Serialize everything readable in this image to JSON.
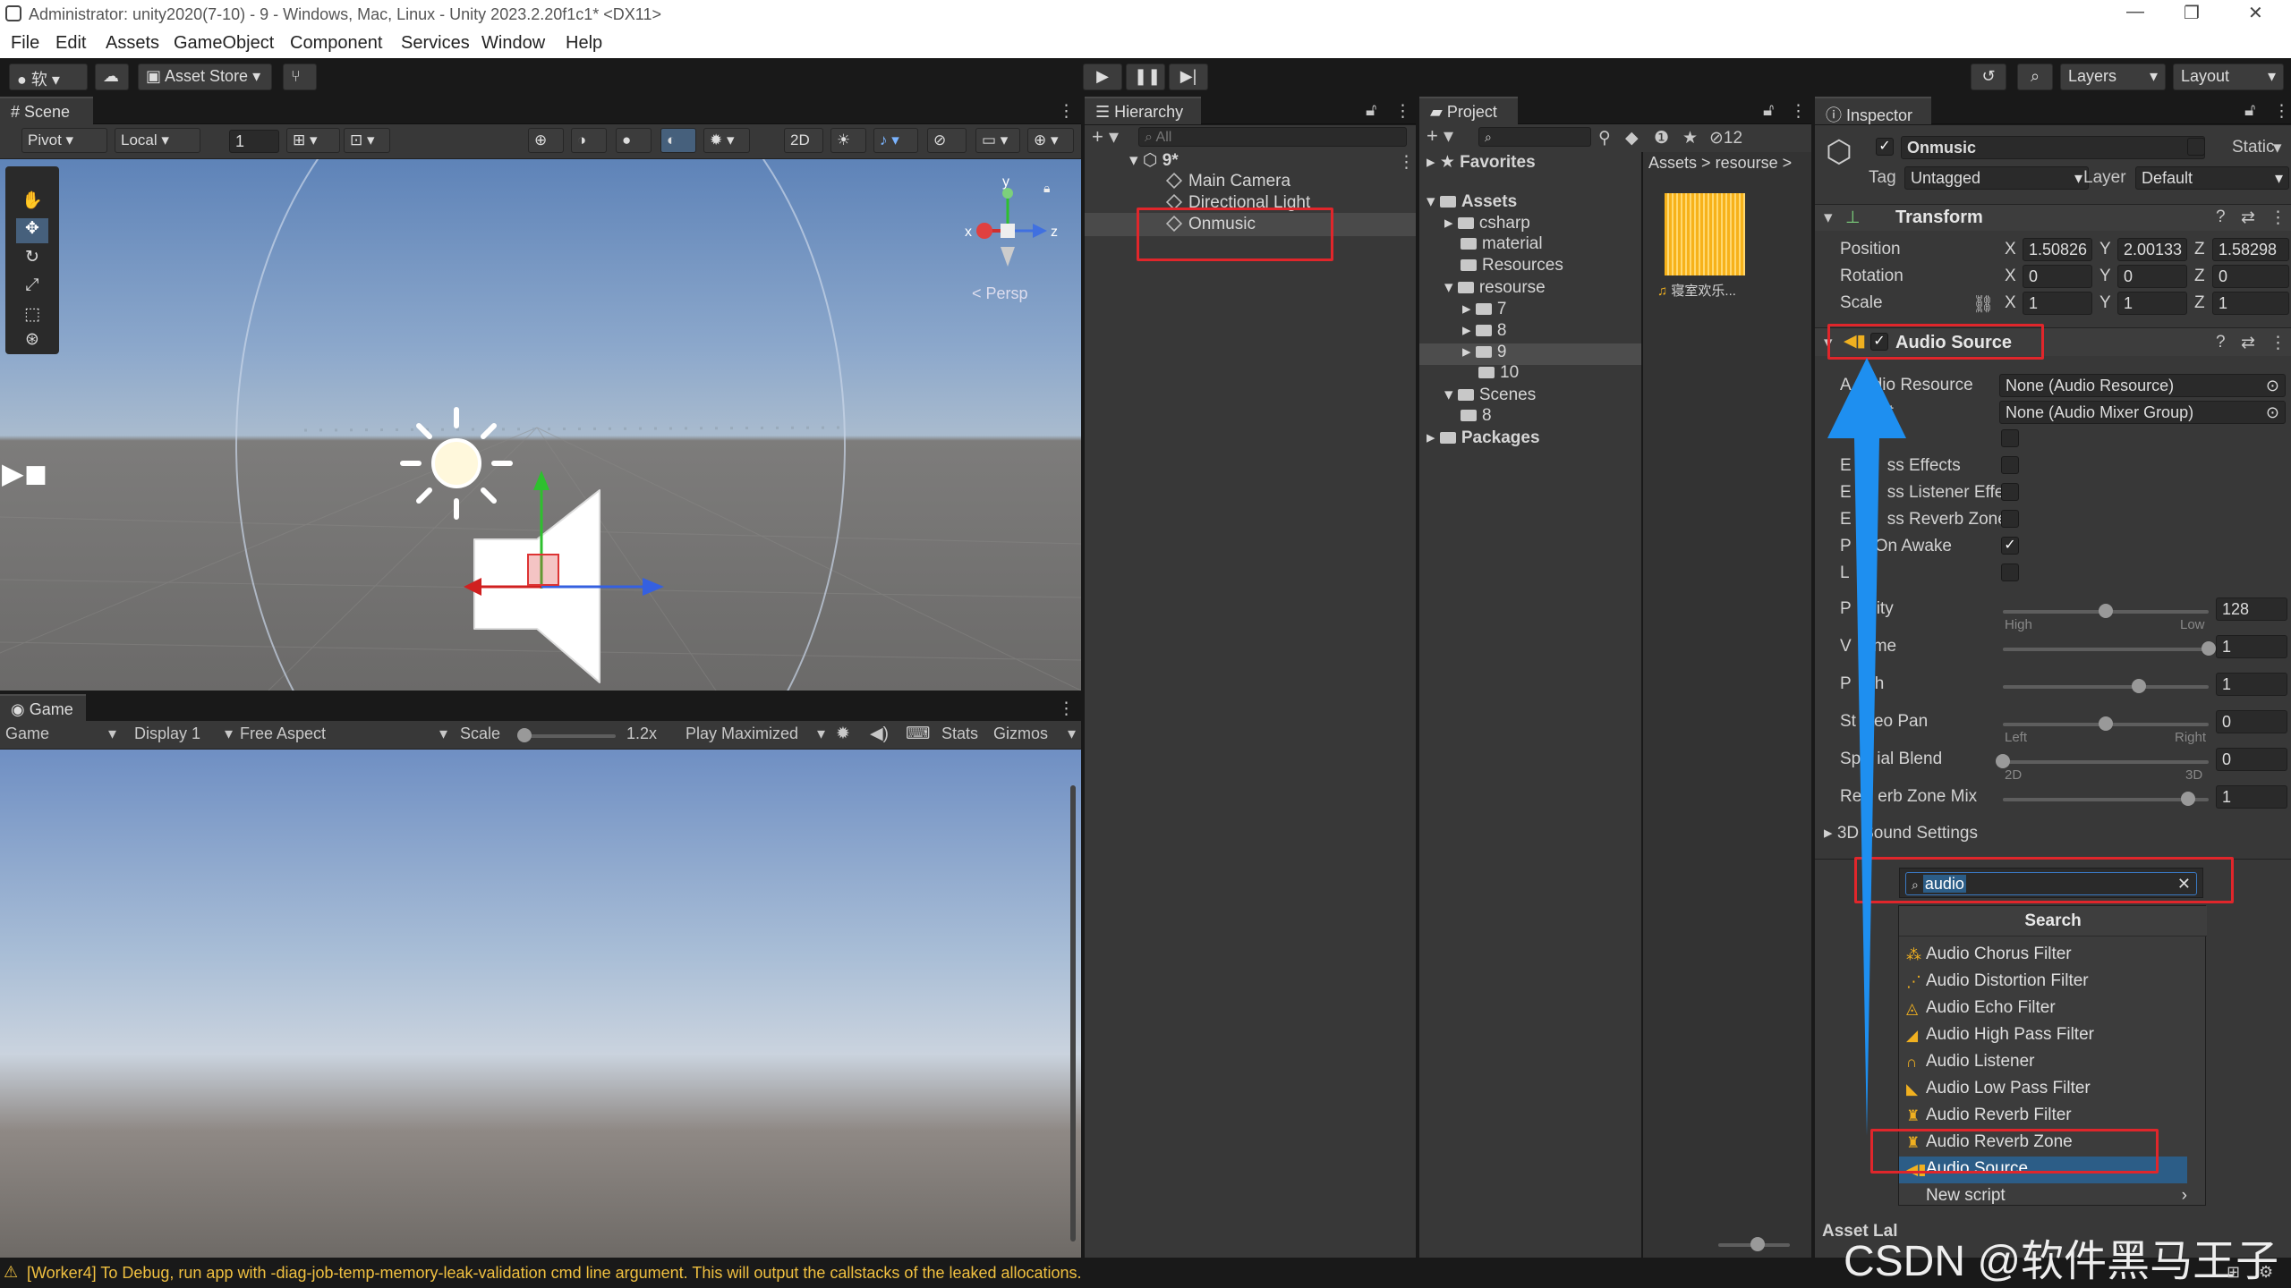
{
  "titlebar": {
    "title": "Administrator: unity2020(7-10) - 9 - Windows, Mac, Linux - Unity 2023.2.20f1c1* <DX11>",
    "min": "—",
    "max": "❐",
    "close": "✕"
  },
  "menu": [
    "File",
    "Edit",
    "Assets",
    "GameObject",
    "Component",
    "Services",
    "Window",
    "Help"
  ],
  "toolbar": {
    "account": "软",
    "asset_store": "Asset Store",
    "layers": "Layers",
    "layout": "Layout"
  },
  "scene": {
    "tab": "Scene",
    "pivot": "Pivot",
    "local": "Local",
    "grid_value": "1",
    "mode_2d": "2D",
    "persp": "Persp",
    "gizmo_x": "x",
    "gizmo_y": "y",
    "gizmo_z": "z"
  },
  "game": {
    "tab": "Game",
    "view": "Game",
    "display": "Display 1",
    "aspect": "Free Aspect",
    "scale_label": "Scale",
    "scale_value": "1.2x",
    "play_mode": "Play Maximized",
    "stats": "Stats",
    "gizmos": "Gizmos"
  },
  "hierarchy": {
    "tab": "Hierarchy",
    "search_placeholder": "All",
    "scene_name": "9*",
    "items": [
      "Main Camera",
      "Directional Light",
      "Onmusic"
    ]
  },
  "project": {
    "tab": "Project",
    "hidden_count": "12",
    "favorites": "Favorites",
    "assets": "Assets",
    "tree": [
      "csharp",
      "material",
      "Resources",
      "resourse",
      "7",
      "8",
      "9",
      "10",
      "Scenes",
      "8"
    ],
    "packages": "Packages",
    "breadcrumb_root": "Assets",
    "breadcrumb_sep": ">",
    "breadcrumb_leaf": "resourse",
    "asset_name": "寝室欢乐..."
  },
  "inspector": {
    "tab": "Inspector",
    "object_name": "Onmusic",
    "static_label": "Static",
    "tag_label": "Tag",
    "tag_value": "Untagged",
    "layer_label": "Layer",
    "layer_value": "Default",
    "transform": {
      "title": "Transform",
      "position_label": "Position",
      "rotation_label": "Rotation",
      "scale_label": "Scale",
      "position": {
        "x": "1.50826",
        "y": "2.00133",
        "z": "1.58298"
      },
      "rotation": {
        "x": "0",
        "y": "0",
        "z": "0"
      },
      "scale": {
        "x": "1",
        "y": "1",
        "z": "1"
      }
    },
    "audio_source": {
      "title": "Audio Source",
      "rows": [
        "A",
        "dio Resource",
        "ut",
        "ss Effects",
        "ss Listener Effe",
        "ss Reverb Zone",
        "On Awake",
        "ity",
        "me",
        "h",
        "eo Pan",
        "ial Blend",
        "erb Zone Mix",
        "3D",
        "Sound Settings"
      ],
      "row_prefix": {
        "bypass_effects": "E",
        "bypass_listener": "E",
        "bypass_reverb": "E",
        "play_on_awake": "P",
        "loop": "L",
        "priority": "P",
        "volume": "V",
        "pitch": "P",
        "stereo_pan": "St",
        "spatial_blend": "Sp",
        "reverb_mix": "Re"
      },
      "resource_value": "None (Audio Resource)",
      "output_value": "None (Audio Mixer Group)",
      "priority": "128",
      "volume": "1",
      "pitch": "1",
      "stereo_pan": "0",
      "spatial_blend": "0",
      "reverb_mix": "1",
      "priority_high": "High",
      "priority_low": "Low",
      "pan_left": "Left",
      "pan_right": "Right",
      "blend_2d": "2D",
      "blend_3d": "3D",
      "priority_fraction": 0.5,
      "volume_fraction": 1.0,
      "pitch_fraction": 0.66,
      "pan_fraction": 0.5,
      "blend_fraction": 0.0,
      "reverb_fraction": 0.9
    },
    "asset_label": "Asset Lal"
  },
  "search_popup": {
    "query": "audio",
    "header": "Search",
    "items": [
      "Audio Chorus Filter",
      "Audio Distortion Filter",
      "Audio Echo Filter",
      "Audio High Pass Filter",
      "Audio Listener",
      "Audio Low Pass Filter",
      "Audio Reverb Filter",
      "Audio Reverb Zone",
      "Audio Source",
      "New script"
    ],
    "selected": "Audio Source",
    "new_script_arrow": "›"
  },
  "status": {
    "message": "[Worker4] To Debug, run app with -diag-job-temp-memory-leak-validation cmd line argument. This will output the callstacks of the leaked allocations."
  },
  "watermark": "CSDN @软件黑马王子",
  "colors": {
    "accent": "#2c5d87",
    "highlight_arrow": "#1e8ff0",
    "annotation_red": "#e0262b"
  }
}
